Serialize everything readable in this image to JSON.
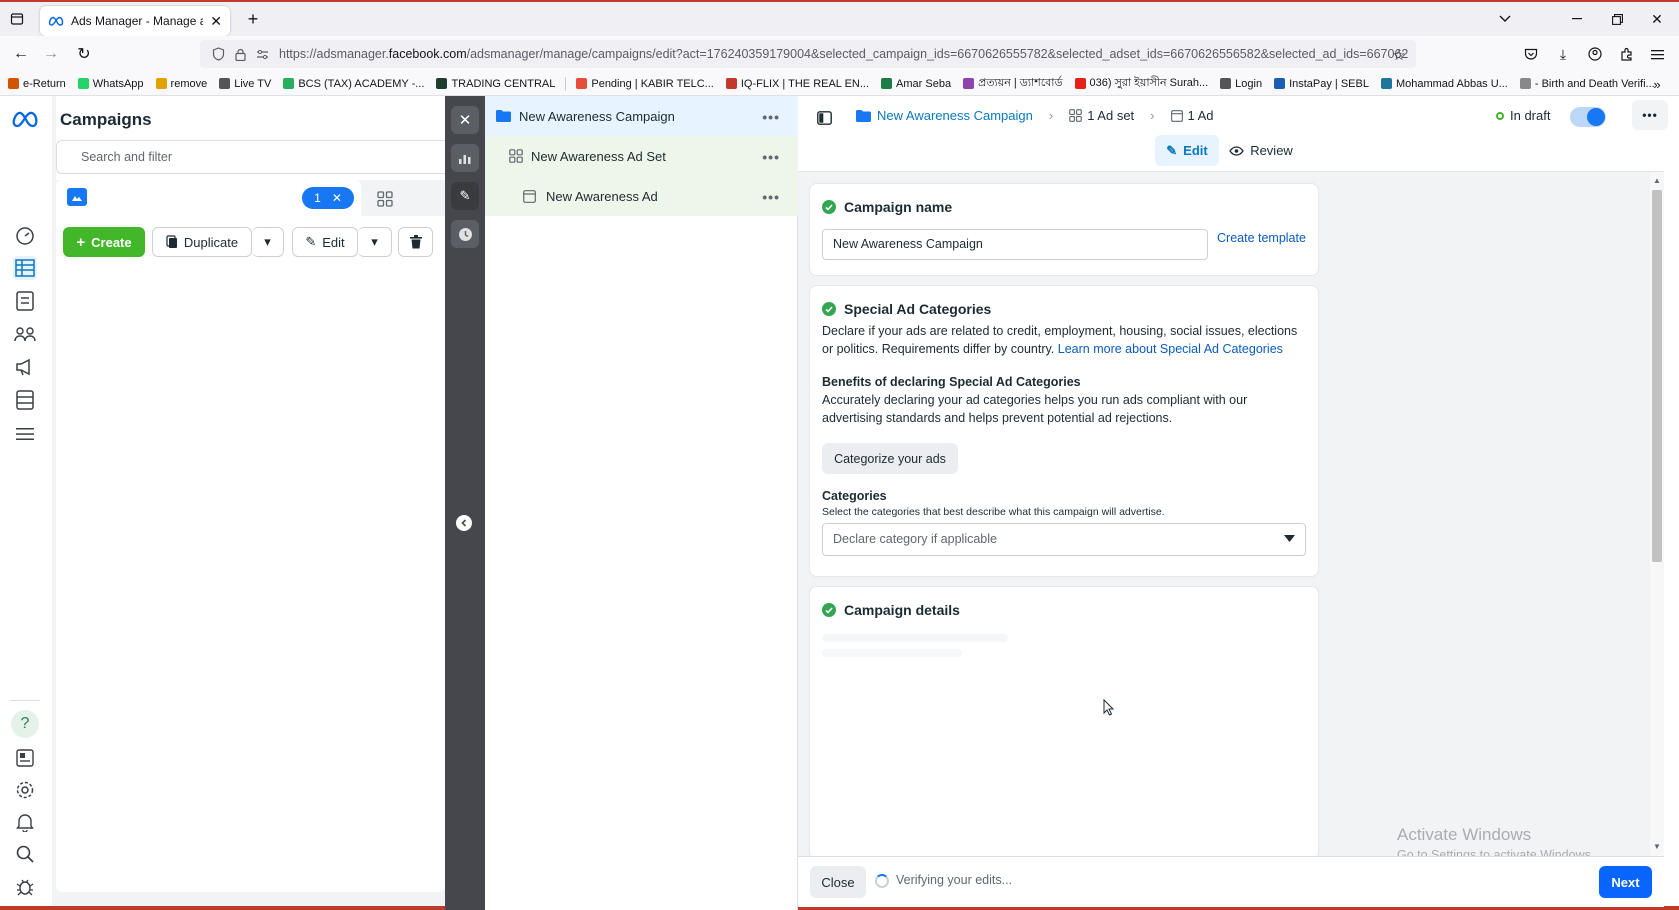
{
  "browser": {
    "tab_title": "Ads Manager - Manage ads - C",
    "url_prefix": "https://adsmanager.",
    "url_domain": "facebook.com",
    "url_rest": "/adsmanager/manage/campaigns/edit?act=176240359179004&selected_campaign_ids=6670626555782&selected_adset_ids=6670626556582&selected_ad_ids=667062"
  },
  "bookmarks": [
    {
      "label": "e-Return",
      "color": "#d35400"
    },
    {
      "label": "WhatsApp",
      "color": "#25d366"
    },
    {
      "label": "remove",
      "color": "#e1a100"
    },
    {
      "label": "Live TV",
      "color": "#555555"
    },
    {
      "label": "BCS (TAX) ACADEMY -...",
      "color": "#27ae60"
    },
    {
      "label": "TRADING CENTRAL",
      "color": "#1f3d2b"
    },
    {
      "label": "Pending | KABIR TELC...",
      "color": "#e74c3c"
    },
    {
      "label": "IQ-FLIX | THE REAL EN...",
      "color": "#c0392b"
    },
    {
      "label": "Amar Seba",
      "color": "#1e7b45"
    },
    {
      "label": "প্রত্যয়ন | ড্যাশবোর্ড",
      "color": "#8e44ad"
    },
    {
      "label": "036) সুরা ইয়াসীন Surah...",
      "color": "#e62117"
    },
    {
      "label": "Login",
      "color": "#555555"
    },
    {
      "label": "InstaPay | SEBL",
      "color": "#1a5fb4"
    },
    {
      "label": "Mohammad Abbas U...",
      "color": "#21759b"
    },
    {
      "label": "- Birth and Death Verifi...",
      "color": "#888888"
    }
  ],
  "campaigns_panel": {
    "title": "Campaigns",
    "search_placeholder": "Search and filter",
    "selected_count": "1",
    "create_label": "Create",
    "duplicate_label": "Duplicate",
    "edit_label": "Edit"
  },
  "tree": {
    "campaign": "New Awareness Campaign",
    "adset": "New Awareness Ad Set",
    "ad": "New Awareness Ad"
  },
  "breadcrumb": {
    "campaign": "New Awareness Campaign",
    "adset": "1 Ad set",
    "ad": "1 Ad",
    "status": "In draft"
  },
  "mode_tabs": {
    "edit": "Edit",
    "review": "Review"
  },
  "campaign_name_card": {
    "title": "Campaign name",
    "value": "New Awareness Campaign",
    "create_template": "Create template"
  },
  "special_ad_card": {
    "title": "Special Ad Categories",
    "desc": "Declare if your ads are related to credit, employment, housing, social issues, elections or politics. Requirements differ by country.",
    "learn_more": "Learn more about Special Ad Categories",
    "benefits_title": "Benefits of declaring Special Ad Categories",
    "benefits_desc": "Accurately declaring your ad categories helps you run ads compliant with our advertising standards and helps prevent potential ad rejections.",
    "categorize_button": "Categorize your ads",
    "categories_label": "Categories",
    "categories_help": "Select the categories that best describe what this campaign will advertise.",
    "select_placeholder": "Declare category if applicable"
  },
  "campaign_details_card": {
    "title": "Campaign details"
  },
  "footer": {
    "close": "Close",
    "verifying": "Verifying your edits...",
    "next": "Next"
  },
  "watermark": {
    "title": "Activate Windows",
    "subtitle": "Go to Settings to activate Windows."
  },
  "colors": {
    "accent": "#0a78be",
    "primary_button": "#0866ff",
    "create_green": "#42b72a",
    "check_green": "#33a652",
    "toggle_blue": "#1877f2"
  }
}
